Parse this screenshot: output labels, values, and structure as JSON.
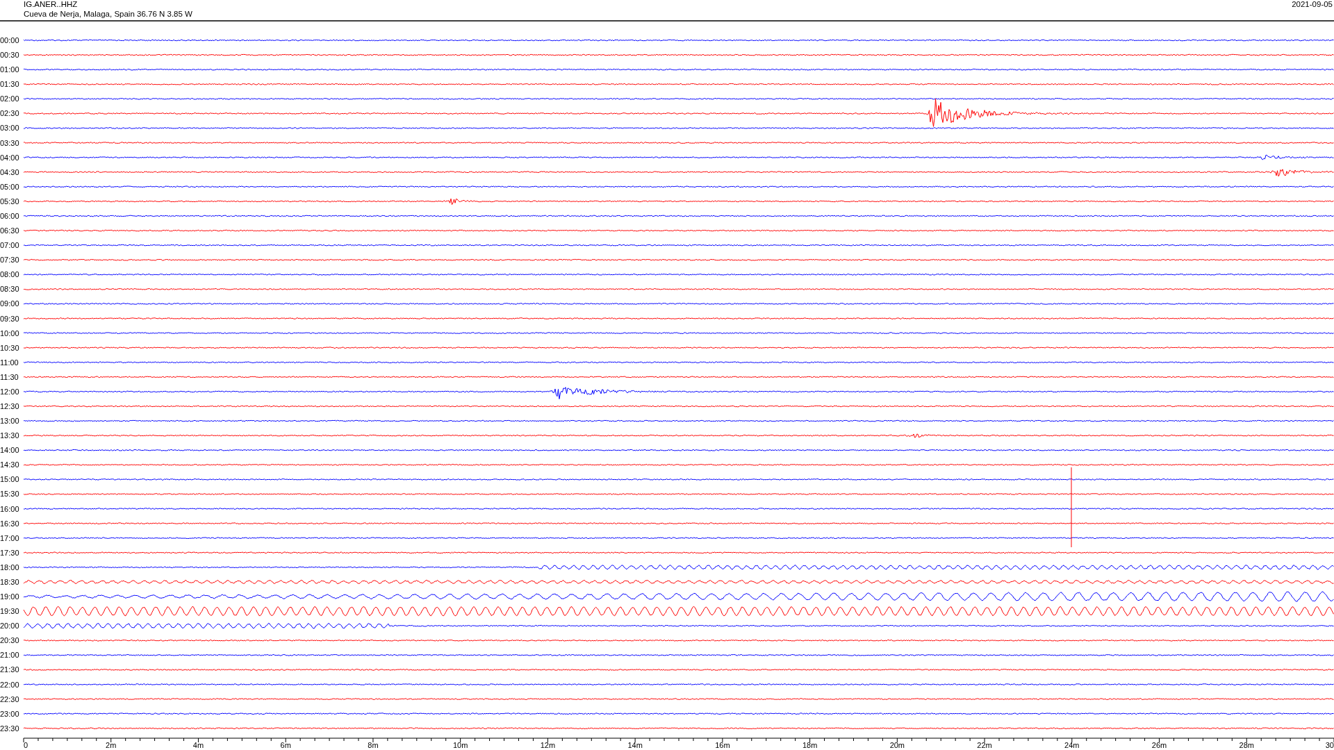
{
  "header": {
    "station": "IG.ANER..HHZ",
    "location": "Cueva de Nerja, Malaga, Spain  36.76 N 3.85 W",
    "date": "2021-09-05"
  },
  "rows": [
    {
      "time": "00:00",
      "color": "#0000ff"
    },
    {
      "time": "00:30",
      "color": "#ff0000"
    },
    {
      "time": "01:00",
      "color": "#0000ff"
    },
    {
      "time": "01:30",
      "color": "#ff0000"
    },
    {
      "time": "02:00",
      "color": "#0000ff"
    },
    {
      "time": "02:30",
      "color": "#ff0000"
    },
    {
      "time": "03:00",
      "color": "#0000ff"
    },
    {
      "time": "03:30",
      "color": "#ff0000"
    },
    {
      "time": "04:00",
      "color": "#0000ff"
    },
    {
      "time": "04:30",
      "color": "#ff0000"
    },
    {
      "time": "05:00",
      "color": "#0000ff"
    },
    {
      "time": "05:30",
      "color": "#ff0000"
    },
    {
      "time": "06:00",
      "color": "#0000ff"
    },
    {
      "time": "06:30",
      "color": "#ff0000"
    },
    {
      "time": "07:00",
      "color": "#0000ff"
    },
    {
      "time": "07:30",
      "color": "#ff0000"
    },
    {
      "time": "08:00",
      "color": "#0000ff"
    },
    {
      "time": "08:30",
      "color": "#ff0000"
    },
    {
      "time": "09:00",
      "color": "#0000ff"
    },
    {
      "time": "09:30",
      "color": "#ff0000"
    },
    {
      "time": "10:00",
      "color": "#0000ff"
    },
    {
      "time": "10:30",
      "color": "#ff0000"
    },
    {
      "time": "11:00",
      "color": "#0000ff"
    },
    {
      "time": "11:30",
      "color": "#ff0000"
    },
    {
      "time": "12:00",
      "color": "#0000ff"
    },
    {
      "time": "12:30",
      "color": "#ff0000"
    },
    {
      "time": "13:00",
      "color": "#0000ff"
    },
    {
      "time": "13:30",
      "color": "#ff0000"
    },
    {
      "time": "14:00",
      "color": "#0000ff"
    },
    {
      "time": "14:30",
      "color": "#ff0000"
    },
    {
      "time": "15:00",
      "color": "#0000ff"
    },
    {
      "time": "15:30",
      "color": "#ff0000"
    },
    {
      "time": "16:00",
      "color": "#0000ff"
    },
    {
      "time": "16:30",
      "color": "#ff0000"
    },
    {
      "time": "17:00",
      "color": "#0000ff"
    },
    {
      "time": "17:30",
      "color": "#ff0000"
    },
    {
      "time": "18:00",
      "color": "#0000ff"
    },
    {
      "time": "18:30",
      "color": "#ff0000"
    },
    {
      "time": "19:00",
      "color": "#0000ff"
    },
    {
      "time": "19:30",
      "color": "#ff0000"
    },
    {
      "time": "20:00",
      "color": "#0000ff"
    },
    {
      "time": "20:30",
      "color": "#ff0000"
    },
    {
      "time": "21:00",
      "color": "#0000ff"
    },
    {
      "time": "21:30",
      "color": "#ff0000"
    },
    {
      "time": "22:00",
      "color": "#0000ff"
    },
    {
      "time": "22:30",
      "color": "#ff0000"
    },
    {
      "time": "23:00",
      "color": "#0000ff"
    },
    {
      "time": "23:30",
      "color": "#ff0000"
    }
  ],
  "x_axis": {
    "ticks": [
      "0",
      "2m",
      "4m",
      "6m",
      "8m",
      "10m",
      "12m",
      "14m",
      "16m",
      "18m",
      "20m",
      "22m",
      "24m",
      "26m",
      "28m",
      "30"
    ]
  }
}
